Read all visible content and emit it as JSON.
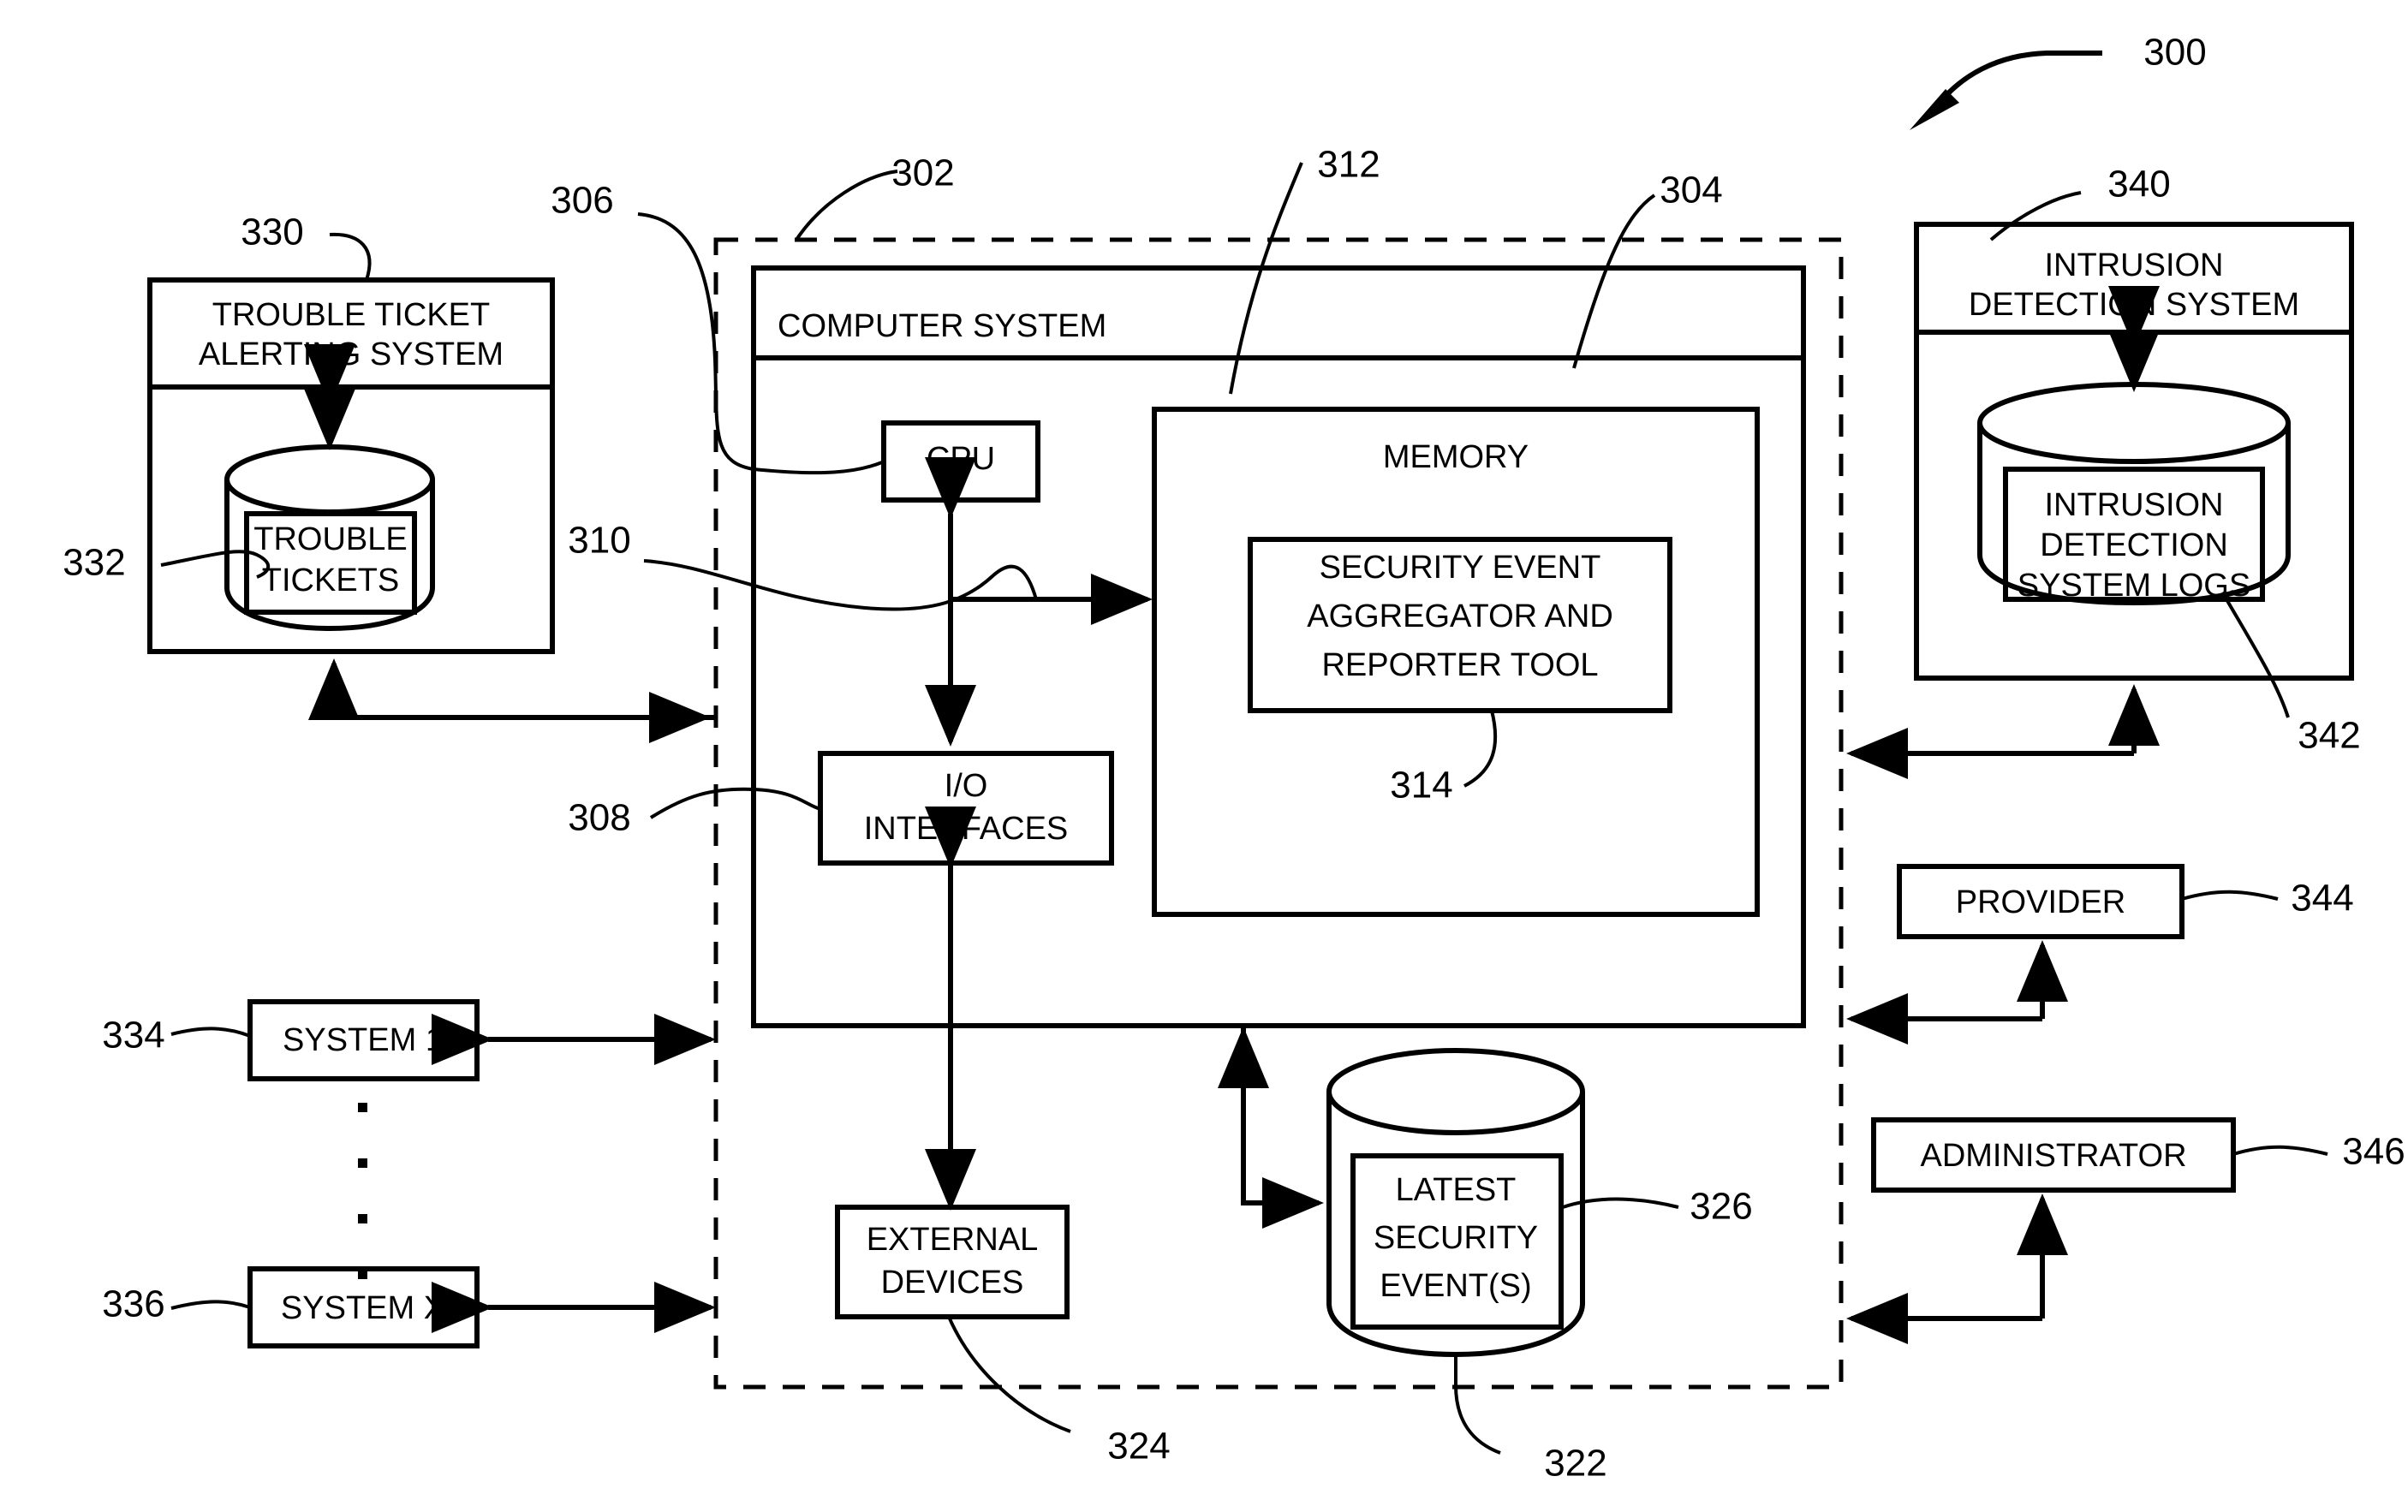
{
  "figure": {
    "title_ref": "300",
    "boundary_ref": "302",
    "boundary_style": "dashed"
  },
  "refs": {
    "system_overall": "300",
    "dashed_boundary": "302",
    "computer_system": "304",
    "bus_306": "306",
    "io_interfaces": "308",
    "bus_310": "310",
    "memory": "312",
    "tool": "314",
    "latest_security_events_db": "322",
    "external_devices": "324",
    "latest_security_events_label": "326",
    "trouble_ticket_alerting_system": "330",
    "trouble_tickets": "332",
    "system_1": "334",
    "system_x": "336",
    "intrusion_detection_system": "340",
    "intrusion_detection_system_logs": "342",
    "provider": "344",
    "administrator": "346"
  },
  "blocks": {
    "trouble_ticket_alerting_system": {
      "line1": "TROUBLE TICKET",
      "line2": "ALERTING SYSTEM",
      "ref": "330"
    },
    "trouble_tickets": {
      "line1": "TROUBLE",
      "line2": "TICKETS",
      "ref": "332"
    },
    "computer_system": {
      "label": "COMPUTER SYSTEM",
      "ref": "304"
    },
    "cpu": {
      "label": "CPU",
      "ref": "306"
    },
    "io_interfaces": {
      "line1": "I/O",
      "line2": "INTERFACES",
      "ref": "308"
    },
    "bus": {
      "ref": "310"
    },
    "memory": {
      "label": "MEMORY",
      "ref": "312"
    },
    "tool": {
      "line1": "SECURITY EVENT",
      "line2": "AGGREGATOR AND",
      "line3": "REPORTER TOOL",
      "ref": "314"
    },
    "external_devices": {
      "line1": "EXTERNAL",
      "line2": "DEVICES",
      "ref": "324"
    },
    "latest_security_events": {
      "line1": "LATEST",
      "line2": "SECURITY",
      "line3": "EVENT(S)",
      "ref": "326",
      "db_ref": "322"
    },
    "system_1": {
      "label": "SYSTEM 1",
      "ref": "334"
    },
    "system_x": {
      "label": "SYSTEM X",
      "ref": "336"
    },
    "vertical_ellipsis": "·",
    "intrusion_detection_system": {
      "line1": "INTRUSION",
      "line2": "DETECTION SYSTEM",
      "ref": "340"
    },
    "intrusion_detection_system_logs": {
      "line1": "INTRUSION",
      "line2": "DETECTION",
      "line3": "SYSTEM LOGS",
      "ref": "342"
    },
    "provider": {
      "label": "PROVIDER",
      "ref": "344"
    },
    "administrator": {
      "label": "ADMINISTRATOR",
      "ref": "346"
    }
  },
  "colors": {
    "stroke": "#000000",
    "background": "#ffffff"
  }
}
